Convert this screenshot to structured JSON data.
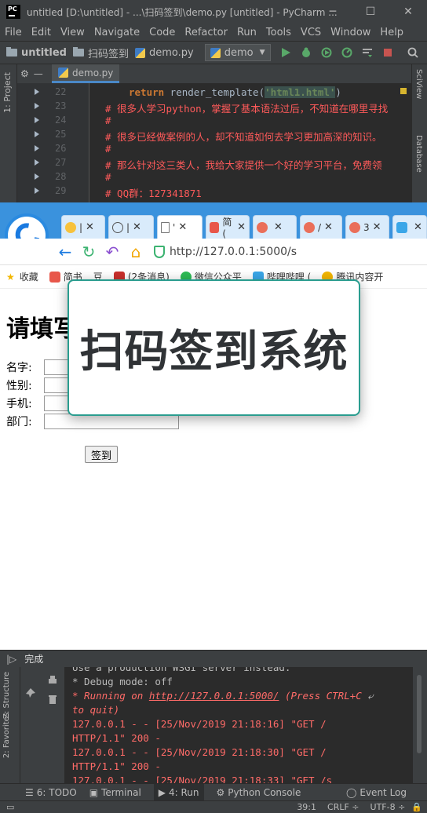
{
  "window": {
    "title": "untitled [D:\\untitled] - ...\\扫码签到\\demo.py [untitled] - PyCharm ...",
    "logo": "PC",
    "controls": [
      "─",
      "☐",
      "✕"
    ]
  },
  "menu": [
    "File",
    "Edit",
    "View",
    "Navigate",
    "Code",
    "Refactor",
    "Run",
    "Tools",
    "VCS",
    "Window",
    "Help"
  ],
  "breadcrumb": {
    "project": "untitled",
    "folder": "扫码签到",
    "file": "demo.py"
  },
  "run_config": "demo",
  "sidebar": {
    "project_label": "1: Project",
    "sciview_label": "SciView",
    "database_label": "Database",
    "structure_label": "Z: Structure",
    "favorites_label": "2: Favorites"
  },
  "editor": {
    "tab": "demo.py",
    "line_numbers": [
      "22",
      "23",
      "24",
      "25",
      "26",
      "27",
      "28",
      "29"
    ],
    "lines": {
      "l22_kw": "return",
      "l22_plain": " render_template(",
      "l22_str": "'html1.html'",
      "l22_end": ")",
      "l23": "# 很多人学习python，掌握了基本语法过后，不知道在哪里寻找",
      "l24": "#",
      "l25": "# 很多已经做案例的人，却不知道如何去学习更加高深的知识。",
      "l26": "#",
      "l27": "# 那么针对这三类人，我给大家提供一个好的学习平台，免费领",
      "l28": "#",
      "l29": "# QQ群：127341871"
    }
  },
  "browser": {
    "tabs": [
      {
        "label": "|",
        "close": "✕"
      },
      {
        "label": "|",
        "close": "✕"
      },
      {
        "label": "'",
        "close": "✕"
      },
      {
        "label": "简(",
        "close": "✕"
      },
      {
        "label": "",
        "close": "✕"
      },
      {
        "label": "/",
        "close": "✕"
      },
      {
        "label": "3",
        "close": "✕"
      },
      {
        "label": "",
        "close": "✕"
      }
    ],
    "url": "http://127.0.0.1:5000/s",
    "bookmarks": {
      "favorites": "收藏",
      "items": [
        "简书",
        "豆",
        "(2条消息)",
        "微信公众平",
        "哔哩哔哩 (",
        "腾讯内容开"
      ]
    },
    "page": {
      "title": "请填写",
      "fields": [
        "名字:",
        "性别:",
        "手机:",
        "部门:"
      ],
      "submit": "签到"
    }
  },
  "overlay": {
    "text": "扫码签到系统"
  },
  "run_panel": {
    "status": "完成",
    "console": [
      "   Use a production WSGI server instead.",
      " * Debug mode: off",
      " * Running on ",
      "http://127.0.0.1:5000/",
      " (Press CTRL+C ",
      "to quit)",
      "127.0.0.1 - - [25/Nov/2019 21:18:16] \"GET /",
      " HTTP/1.1\" 200 -",
      "127.0.0.1 - - [25/Nov/2019 21:18:30] \"GET /",
      " HTTP/1.1\" 200 -",
      "127.0.0.1 - - [25/Nov/2019 21:18:33] \"GET /s"
    ]
  },
  "bottom_tabs": [
    {
      "label": "6: TODO"
    },
    {
      "label": "Terminal"
    },
    {
      "label": "4: Run"
    },
    {
      "label": "Python Console"
    },
    {
      "label": "Event Log"
    }
  ],
  "status": {
    "position": "39:1",
    "line_sep": "CRLF ÷",
    "encoding": "UTF-8 ÷"
  },
  "colors": {
    "ide_bg": "#3c3f41",
    "editor_bg": "#2b2b2b",
    "comment_red": "#ff5a5a",
    "browser_tabbar": "#3a92dd",
    "overlay_border": "#2a9d8f"
  }
}
